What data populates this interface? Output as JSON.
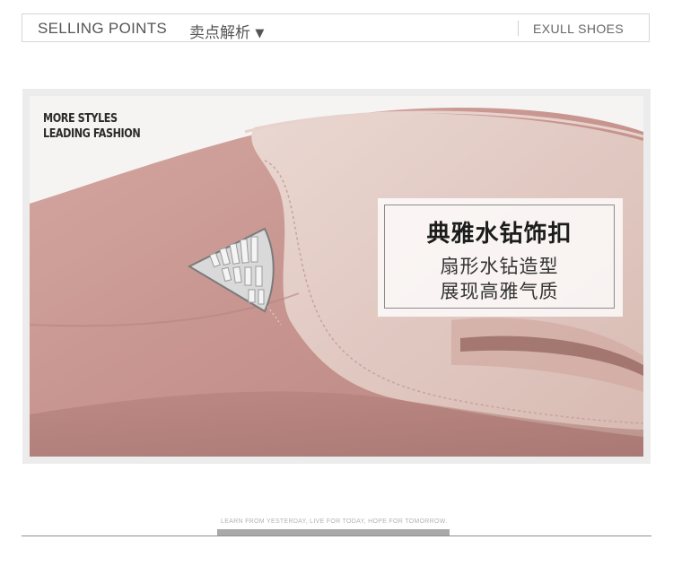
{
  "header": {
    "title_en": "SELLING POINTS",
    "title_cn": "卖点解析",
    "dropdown_glyph": "▼",
    "brand": "EXULL SHOES"
  },
  "photo": {
    "tagline_line1": "MORE STYLES",
    "tagline_line2": "LEADING FASHION",
    "callout": {
      "heading": "典雅水钻饰扣",
      "line1": "扇形水钻造型",
      "line2": "展现高雅气质"
    },
    "colors": {
      "suede": "#c99893",
      "lining": "#e2c9c2",
      "background": "#f6f4f3"
    }
  },
  "footer": {
    "motto": "LEARN FROM YESTERDAY, LIVE FOR TODAY, HOPE FOR TOMORROW."
  }
}
